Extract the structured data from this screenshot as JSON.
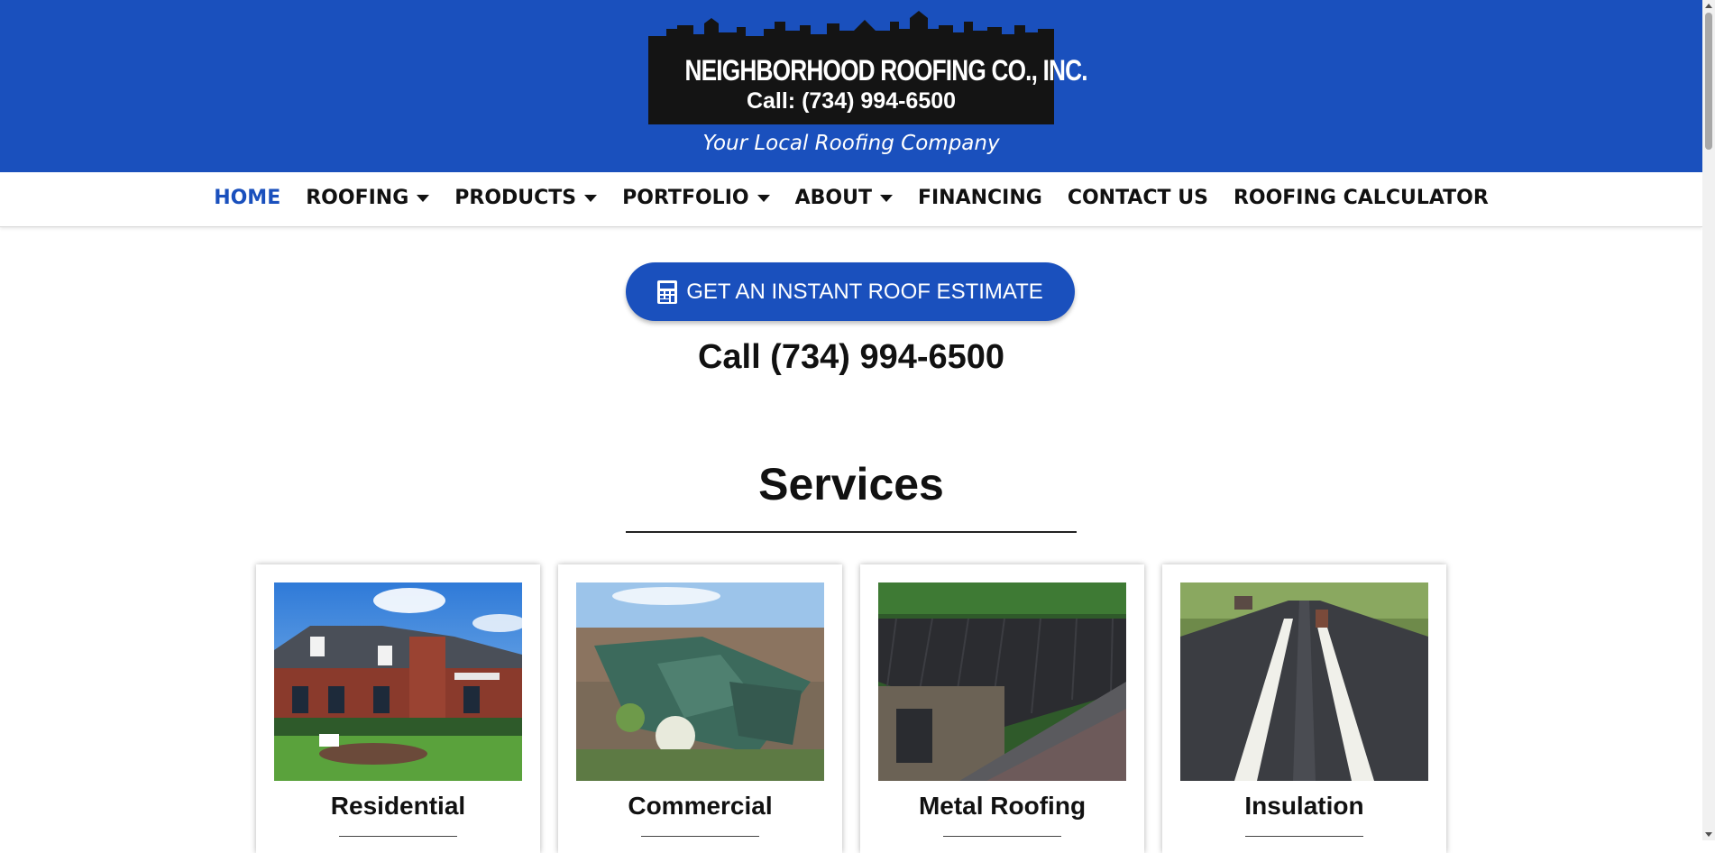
{
  "header": {
    "logo_name": "NEIGHBORHOOD ROOFING CO., INC.",
    "logo_phone": "Call: (734) 994-6500",
    "tagline": "Your Local Roofing Company",
    "brand_color": "#1a50bd"
  },
  "nav": {
    "items": [
      {
        "label": "HOME",
        "active": true,
        "dropdown": false
      },
      {
        "label": "ROOFING",
        "dropdown": true
      },
      {
        "label": "PRODUCTS",
        "dropdown": true
      },
      {
        "label": "PORTFOLIO",
        "dropdown": true
      },
      {
        "label": "ABOUT",
        "dropdown": true
      },
      {
        "label": "FINANCING",
        "dropdown": false
      },
      {
        "label": "CONTACT US",
        "dropdown": false
      },
      {
        "label": "ROOFING CALCULATOR",
        "dropdown": false
      }
    ]
  },
  "cta": {
    "label": "GET AN INSTANT ROOF ESTIMATE",
    "icon": "calculator-icon"
  },
  "phone": "Call (734) 994-6500",
  "services": {
    "title": "Services",
    "cards": [
      {
        "title": "Residential",
        "image": "brick-house-photo"
      },
      {
        "title": "Commercial",
        "image": "aerial-green-roof-photo"
      },
      {
        "title": "Metal Roofing",
        "image": "metal-roof-photo"
      },
      {
        "title": "Insulation",
        "image": "ridge-vent-roof-photo"
      }
    ]
  }
}
